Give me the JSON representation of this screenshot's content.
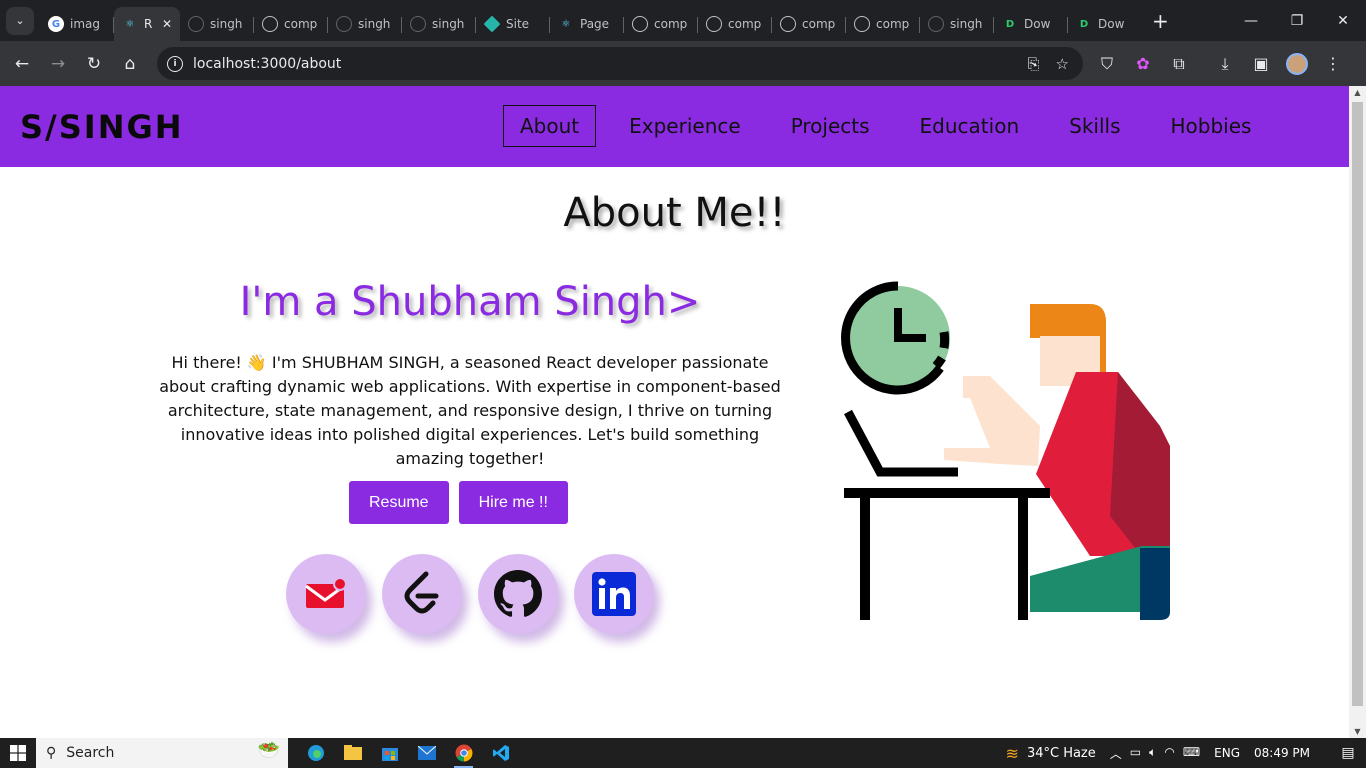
{
  "browser": {
    "tabs": [
      {
        "label": "imag",
        "favicon": "google-icon",
        "active": false
      },
      {
        "label": "R",
        "favicon": "react-icon",
        "active": true
      },
      {
        "label": "singh",
        "favicon": "github-icon",
        "active": false
      },
      {
        "label": "comp",
        "favicon": "globe-icon",
        "active": false
      },
      {
        "label": "singh",
        "favicon": "github-icon",
        "active": false
      },
      {
        "label": "singh",
        "favicon": "github-icon",
        "active": false
      },
      {
        "label": "Site",
        "favicon": "netlify-icon",
        "active": false
      },
      {
        "label": "Page",
        "favicon": "react-icon",
        "active": false
      },
      {
        "label": "comp",
        "favicon": "globe-icon",
        "active": false
      },
      {
        "label": "comp",
        "favicon": "globe-icon",
        "active": false
      },
      {
        "label": "comp",
        "favicon": "globe-icon",
        "active": false
      },
      {
        "label": "comp",
        "favicon": "globe-icon",
        "active": false
      },
      {
        "label": "singh",
        "favicon": "github-icon",
        "active": false
      },
      {
        "label": "Dow",
        "favicon": "d-icon",
        "active": false
      },
      {
        "label": "Dow",
        "favicon": "d-icon",
        "active": false
      }
    ],
    "url": "localhost:3000/about"
  },
  "site": {
    "logo": "S/SINGH",
    "nav": [
      "About",
      "Experience",
      "Projects",
      "Education",
      "Skills",
      "Hobbies"
    ],
    "active_nav": "About",
    "accent": "#8a2be2"
  },
  "about": {
    "title": "About Me!!",
    "intro": "I'm a Shubham Singh>",
    "bio": "Hi there! 👋 I'm SHUBHAM SINGH, a seasoned React developer passionate about crafting dynamic web applications. With expertise in component-based architecture, state management, and responsive design, I thrive on turning innovative ideas into polished digital experiences. Let's build something amazing together!",
    "buttons": {
      "resume": "Resume",
      "hire": "Hire me !!"
    },
    "social": [
      "mail-icon",
      "leetcode-icon",
      "github-icon",
      "linkedin-icon"
    ]
  },
  "taskbar": {
    "search": "Search",
    "weather": "34°C  Haze",
    "lang": "ENG",
    "time": "08:49 PM"
  }
}
